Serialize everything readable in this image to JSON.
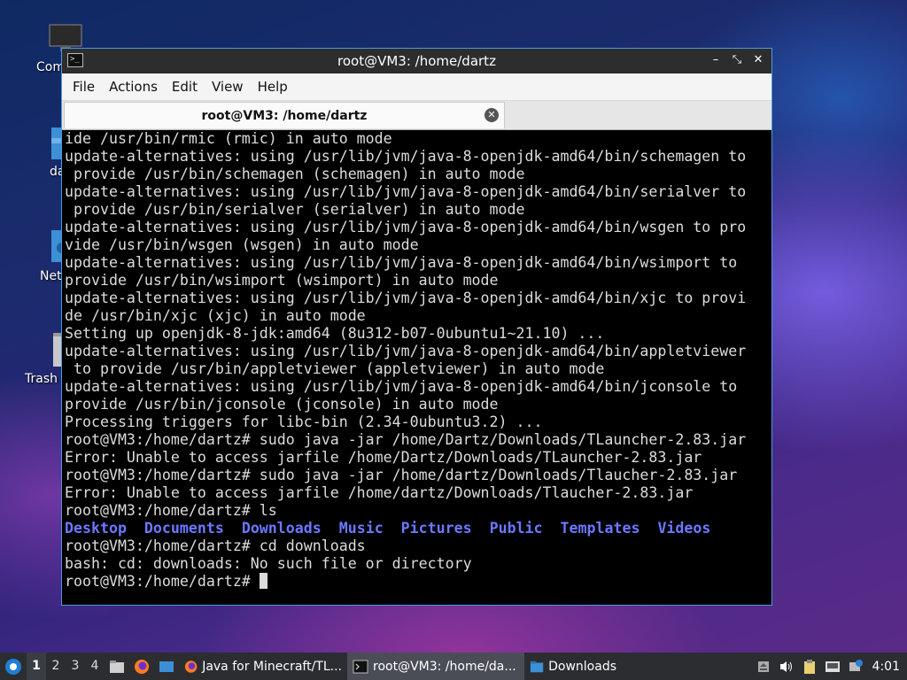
{
  "desktop": {
    "icons": [
      {
        "label": "Com"
      },
      {
        "label": "da"
      },
      {
        "label": "Net"
      },
      {
        "label": "Trash"
      }
    ]
  },
  "window": {
    "title": "root@VM3: /home/dartz",
    "menu": [
      "File",
      "Actions",
      "Edit",
      "View",
      "Help"
    ],
    "tab": {
      "label": "root@VM3: /home/dartz"
    }
  },
  "terminal": {
    "lines": [
      "ide /usr/bin/rmic (rmic) in auto mode",
      "update-alternatives: using /usr/lib/jvm/java-8-openjdk-amd64/bin/schemagen to",
      " provide /usr/bin/schemagen (schemagen) in auto mode",
      "update-alternatives: using /usr/lib/jvm/java-8-openjdk-amd64/bin/serialver to",
      " provide /usr/bin/serialver (serialver) in auto mode",
      "update-alternatives: using /usr/lib/jvm/java-8-openjdk-amd64/bin/wsgen to pro",
      "vide /usr/bin/wsgen (wsgen) in auto mode",
      "update-alternatives: using /usr/lib/jvm/java-8-openjdk-amd64/bin/wsimport to",
      "provide /usr/bin/wsimport (wsimport) in auto mode",
      "update-alternatives: using /usr/lib/jvm/java-8-openjdk-amd64/bin/xjc to provi",
      "de /usr/bin/xjc (xjc) in auto mode",
      "Setting up openjdk-8-jdk:amd64 (8u312-b07-0ubuntu1~21.10) ...",
      "update-alternatives: using /usr/lib/jvm/java-8-openjdk-amd64/bin/appletviewer",
      " to provide /usr/bin/appletviewer (appletviewer) in auto mode",
      "update-alternatives: using /usr/lib/jvm/java-8-openjdk-amd64/bin/jconsole to",
      "provide /usr/bin/jconsole (jconsole) in auto mode",
      "Processing triggers for libc-bin (2.34-0ubuntu3.2) ...",
      "root@VM3:/home/dartz# sudo java -jar /home/Dartz/Downloads/TLauncher-2.83.jar",
      "Error: Unable to access jarfile /home/Dartz/Downloads/TLauncher-2.83.jar",
      "root@VM3:/home/dartz# sudo java -jar /home/dartz/Downloads/Tlaucher-2.83.jar",
      "Error: Unable to access jarfile /home/dartz/Downloads/Tlaucher-2.83.jar",
      "root@VM3:/home/dartz# ls"
    ],
    "ls_output": [
      "Desktop",
      "Documents",
      "Downloads",
      "Music",
      "Pictures",
      "Public",
      "Templates",
      "Videos"
    ],
    "after_lines": [
      "root@VM3:/home/dartz# cd downloads",
      "bash: cd: downloads: No such file or directory"
    ],
    "prompt": "root@VM3:/home/dartz# "
  },
  "taskbar": {
    "workspaces": [
      "1",
      "2",
      "3",
      "4"
    ],
    "tasks": [
      {
        "label": "Java for Minecraft/TL...",
        "icon": "firefox-icon"
      },
      {
        "label": "root@VM3: /home/da...",
        "icon": "terminal-icon"
      },
      {
        "label": "Downloads",
        "icon": "folder-icon"
      }
    ],
    "clock": "4:01"
  },
  "colors": {
    "ls_dir": "#6b78ff",
    "window_border": "#4a9be0",
    "taskbar": "#2b2d31"
  }
}
